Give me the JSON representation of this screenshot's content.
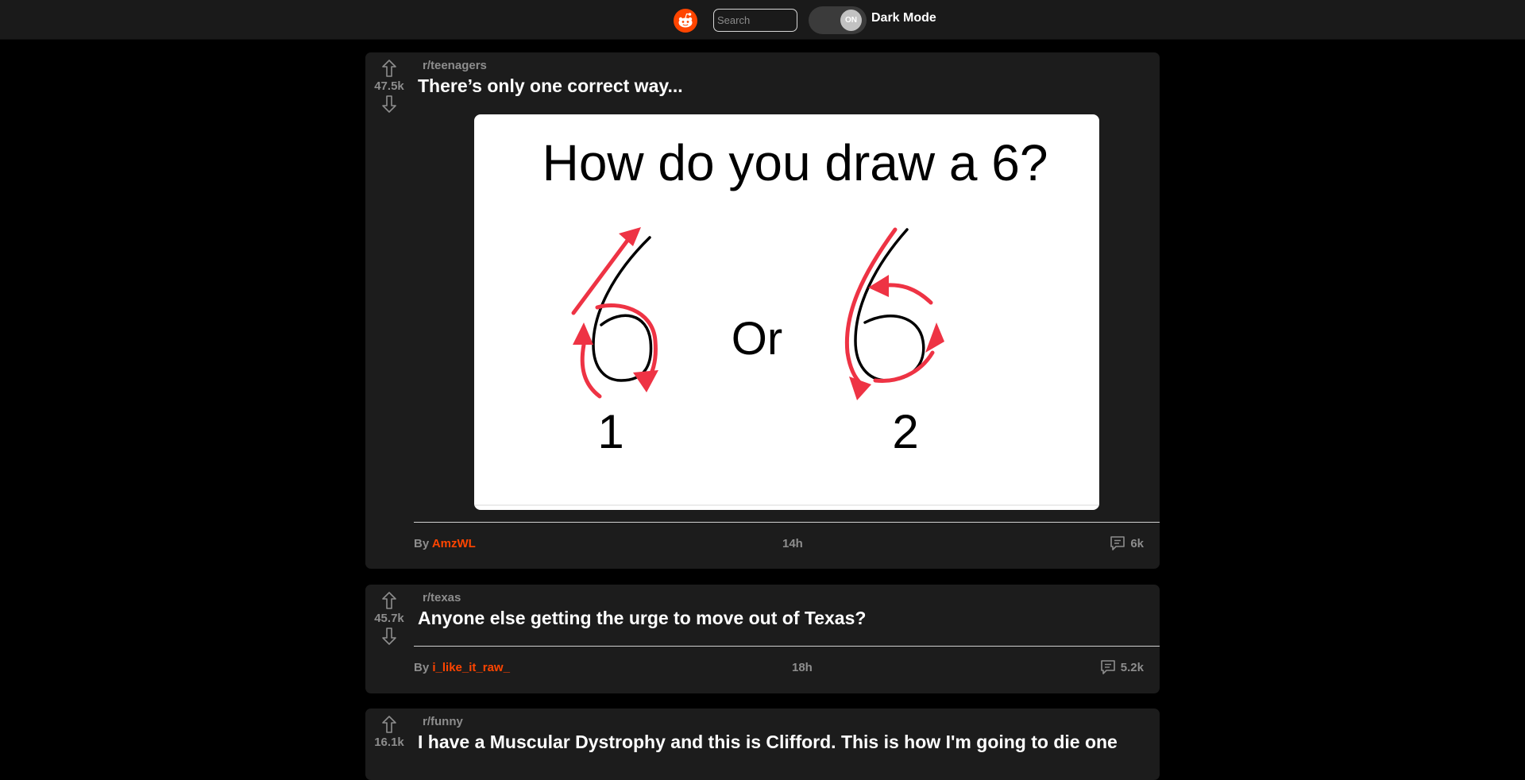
{
  "header": {
    "search_placeholder": "Search",
    "toggle_state": "ON",
    "dark_mode_label": "Dark Mode"
  },
  "colors": {
    "brand": "#ff4500",
    "background": "#000000",
    "card": "#1c1c1c",
    "muted_text": "#8d8d8d"
  },
  "posts": [
    {
      "subreddit": "r/teenagers",
      "votes": "47.5k",
      "title": "There’s only one correct way...",
      "by_label": "By",
      "author": "AmzWL",
      "time": "14h",
      "comments": "6k",
      "image": {
        "heading": "How do you draw a 6?",
        "option1": "1",
        "or_label": "Or",
        "option2": "2"
      }
    },
    {
      "subreddit": "r/texas",
      "votes": "45.7k",
      "title": "Anyone else getting the urge to move out of Texas?",
      "by_label": "By",
      "author": "i_like_it_raw_",
      "time": "18h",
      "comments": "5.2k"
    },
    {
      "subreddit": "r/funny",
      "votes": "16.1k",
      "title": "I have a Muscular Dystrophy and this is Clifford. This is how I'm going to die one"
    }
  ],
  "icons": [
    "reddit-logo-icon",
    "upvote-arrow-icon",
    "downvote-arrow-icon",
    "comment-bubble-icon"
  ]
}
